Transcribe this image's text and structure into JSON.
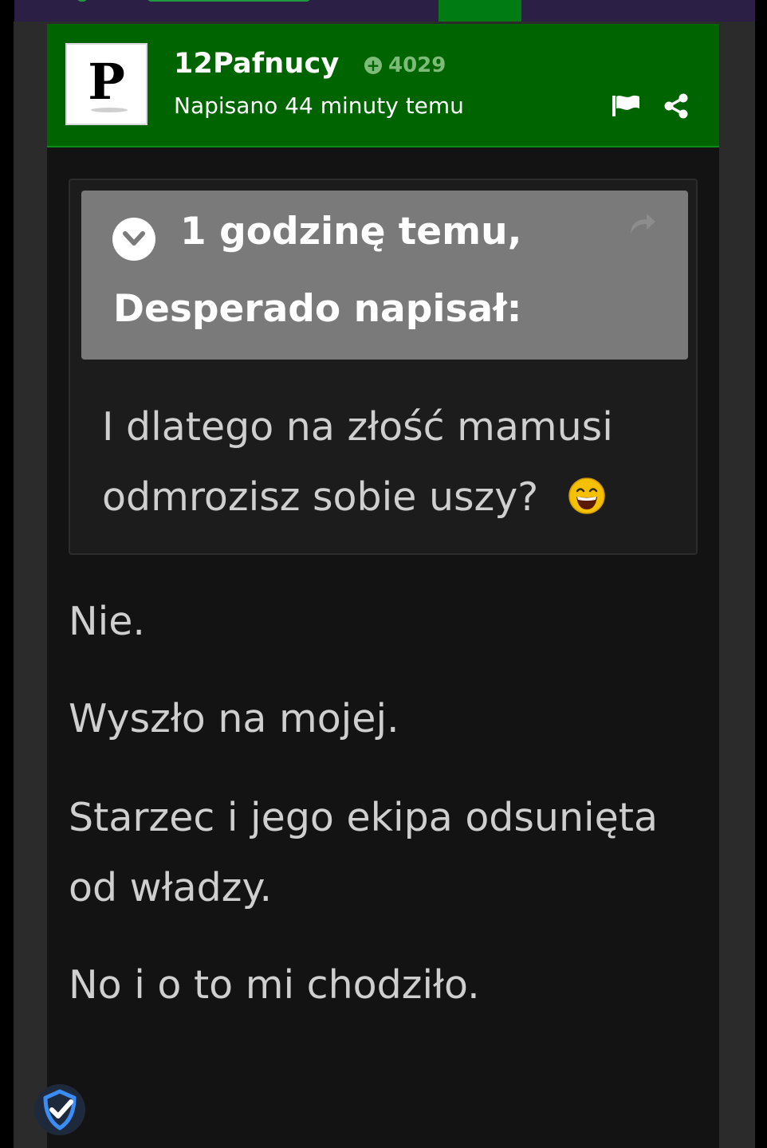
{
  "header": {
    "avatar_letter": "P",
    "username": "12Pafnucy",
    "reputation": "4029",
    "posted_time": "Napisano 44 minuty temu",
    "flag_icon": "flag-icon",
    "share_icon": "share-icon"
  },
  "quote": {
    "time": "1 godzinę temu,",
    "author": "Desperado napisał:",
    "text_line1": "I dlatego na złość mamusi",
    "text_line2": "odmrozisz sobie uszy?",
    "emoji": "laughing-emoji"
  },
  "body": {
    "para1": "Nie.",
    "para2": "Wyszło na mojej.",
    "para3": "Starzec i jego ekipa odsunięta od władzy.",
    "para4": "No i o to mi chodziło."
  },
  "colors": {
    "header_green": "#006400",
    "nav_purple": "#2b1f46",
    "quote_head_gray": "#7a7a7a",
    "reputation_green": "#7dbb78"
  }
}
